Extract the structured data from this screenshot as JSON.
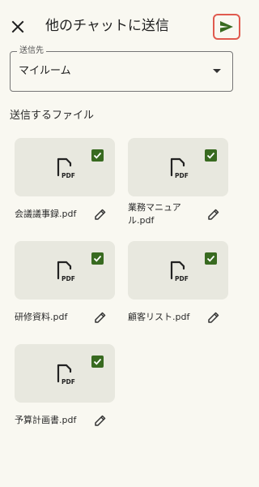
{
  "header": {
    "title": "他のチャットに送信",
    "close_icon": "close-icon",
    "send_icon": "send-icon"
  },
  "destination": {
    "label": "送信先",
    "value": "マイルーム"
  },
  "files_section": {
    "label": "送信するファイル",
    "files": [
      {
        "name": "会議議事録.pdf",
        "type": "PDF",
        "checked": true
      },
      {
        "name": "業務マニュアル.pdf",
        "type": "PDF",
        "checked": true
      },
      {
        "name": "研修資料.pdf",
        "type": "PDF",
        "checked": true
      },
      {
        "name": "顧客リスト.pdf",
        "type": "PDF",
        "checked": true
      },
      {
        "name": "予算計画書.pdf",
        "type": "PDF",
        "checked": true
      }
    ]
  },
  "colors": {
    "accent": "#386a20",
    "send_highlight": "#e05a4f",
    "background": "#f9f8f1",
    "thumb_background": "#e8e8df"
  }
}
